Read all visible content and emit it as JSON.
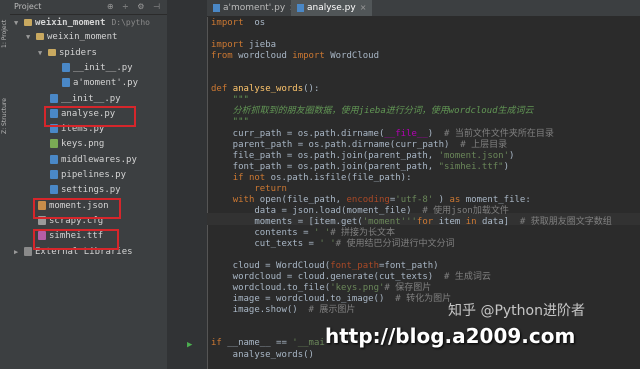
{
  "side_tabs": [
    "1: Project",
    "Structure",
    "Z: Structure"
  ],
  "project_panel": {
    "title": "Project",
    "header_icons": "⊕ ÷ ⚙ ⊣",
    "tree": [
      {
        "label": "weixin_moment",
        "path": "D:\\pytho",
        "type": "folder",
        "arrow": "▼",
        "bold": true
      },
      {
        "label": "weixin_moment",
        "type": "folder",
        "arrow": "▼"
      },
      {
        "label": "spiders",
        "type": "folder",
        "arrow": "▼"
      },
      {
        "label": "__init__.py",
        "type": "py"
      },
      {
        "label": "a'moment'.py",
        "type": "py"
      },
      {
        "label": "__init__.py",
        "type": "py"
      },
      {
        "label": "analyse.py",
        "type": "py"
      },
      {
        "label": "items.py",
        "type": "py"
      },
      {
        "label": "keys.png",
        "type": "png"
      },
      {
        "label": "middlewares.py",
        "type": "py"
      },
      {
        "label": "pipelines.py",
        "type": "py"
      },
      {
        "label": "settings.py",
        "type": "py"
      },
      {
        "label": "moment.json",
        "type": "json"
      },
      {
        "label": "scrapy.cfg",
        "type": "cfg"
      },
      {
        "label": "simhei.ttf",
        "type": "ttf"
      },
      {
        "label": "External Libraries",
        "type": "libs",
        "arrow": "▶"
      }
    ]
  },
  "tabs": [
    {
      "label": "a'moment'.py",
      "active": false
    },
    {
      "label": "analyse.py",
      "active": true
    }
  ],
  "code": [
    [
      [
        "kw",
        "import"
      ],
      [
        "",
        "  os"
      ]
    ],
    [],
    [
      [
        "kw",
        "import"
      ],
      [
        "",
        " jieba"
      ]
    ],
    [
      [
        "kw",
        "from"
      ],
      [
        "",
        " wordcloud "
      ],
      [
        "kw",
        "import"
      ],
      [
        "",
        " WordCloud"
      ]
    ],
    [],
    [],
    [
      [
        "kw",
        "def"
      ],
      [
        "",
        " "
      ],
      [
        "fn",
        "analyse_words"
      ],
      [
        "",
        "():"
      ]
    ],
    [
      [
        "doc",
        "    \"\"\""
      ]
    ],
    [
      [
        "doc",
        "    分析抓取到的朋友圈数据，使用jieba进行分词，使用wordcloud生成词云"
      ]
    ],
    [
      [
        "doc",
        "    \"\"\""
      ]
    ],
    [
      [
        "",
        "    curr_path = os.path.dirname("
      ],
      [
        "mg",
        "__file__"
      ],
      [
        "",
        ")  "
      ],
      [
        "cm",
        "# 当前文件文件夹所在目录"
      ]
    ],
    [
      [
        "",
        "    parent_path = os.path.dirname(curr_path)  "
      ],
      [
        "cm",
        "# 上层目录"
      ]
    ],
    [
      [
        "",
        "    file_path = os.path.join(parent_path, "
      ],
      [
        "str",
        "'moment.json'"
      ],
      [
        "",
        ")"
      ]
    ],
    [
      [
        "",
        "    font_path = os.path.join(parent_path, "
      ],
      [
        "str",
        "\"simhei.ttf\""
      ],
      [
        "",
        ")"
      ]
    ],
    [
      [
        "",
        "    "
      ],
      [
        "kw",
        "if not"
      ],
      [
        "",
        " os.path.isfile(file_path):"
      ]
    ],
    [
      [
        "kw",
        "        return"
      ]
    ],
    [
      [
        "",
        "    "
      ],
      [
        "kw",
        "with"
      ],
      [
        "",
        " open(file_path, "
      ],
      [
        "param",
        "encoding"
      ],
      [
        "",
        "="
      ],
      [
        "str",
        "'utf-8'"
      ],
      [
        "",
        " ) "
      ],
      [
        "kw",
        "as"
      ],
      [
        "",
        " moment_file:"
      ]
    ],
    [
      [
        "",
        "        data = json.load(moment_file)  "
      ],
      [
        "cm",
        "# 使用json加载文件"
      ]
    ],
    [
      [
        "",
        "        moments = [item.get("
      ],
      [
        "str",
        "'moment'"
      ],
      [
        ", "
      ],
      [
        "str",
        "''"
      ],
      [
        ") "
      ],
      [
        "kw",
        "for"
      ],
      [
        "",
        " item "
      ],
      [
        "kw",
        "in"
      ],
      [
        "",
        " data]  "
      ],
      [
        "cm",
        "# 获取朋友圈文字数组"
      ]
    ],
    [
      [
        "",
        "        contents = "
      ],
      [
        "str",
        "' '"
      ],
      [
        ".join(moments)  "
      ],
      [
        "cm",
        "# 拼接为长文本"
      ]
    ],
    [
      [
        "",
        "        cut_texts = "
      ],
      [
        "str",
        "' '"
      ],
      [
        ".join(jieba.cut(contents))  "
      ],
      [
        "cm",
        "# 使用结巴分词进行中文分词"
      ]
    ],
    [],
    [
      [
        "",
        "    cloud = WordCloud("
      ],
      [
        "param",
        "font_path"
      ],
      [
        "",
        "=font_path)"
      ]
    ],
    [
      [
        "",
        "    wordcloud = cloud.generate(cut_texts)  "
      ],
      [
        "cm",
        "# 生成词云"
      ]
    ],
    [
      [
        "",
        "    wordcloud.to_file("
      ],
      [
        "str",
        "'keys.png'"
      ],
      [
        ")  "
      ],
      [
        "cm",
        "# 保存图片"
      ]
    ],
    [
      [
        "",
        "    image = wordcloud.to_image()  "
      ],
      [
        "cm",
        "# 转化为图片"
      ]
    ],
    [
      [
        "",
        "    image.show()  "
      ],
      [
        "cm",
        "# 展示图片"
      ]
    ],
    [],
    [],
    [
      [
        "kw",
        "if"
      ],
      [
        "",
        " __name__ == "
      ],
      [
        "str",
        "'__mai"
      ]
    ],
    [
      [
        "",
        "    analyse_words()"
      ]
    ]
  ],
  "watermark": "http://blog.a2009.com",
  "zh_watermark": "知乎 @Python进阶者"
}
